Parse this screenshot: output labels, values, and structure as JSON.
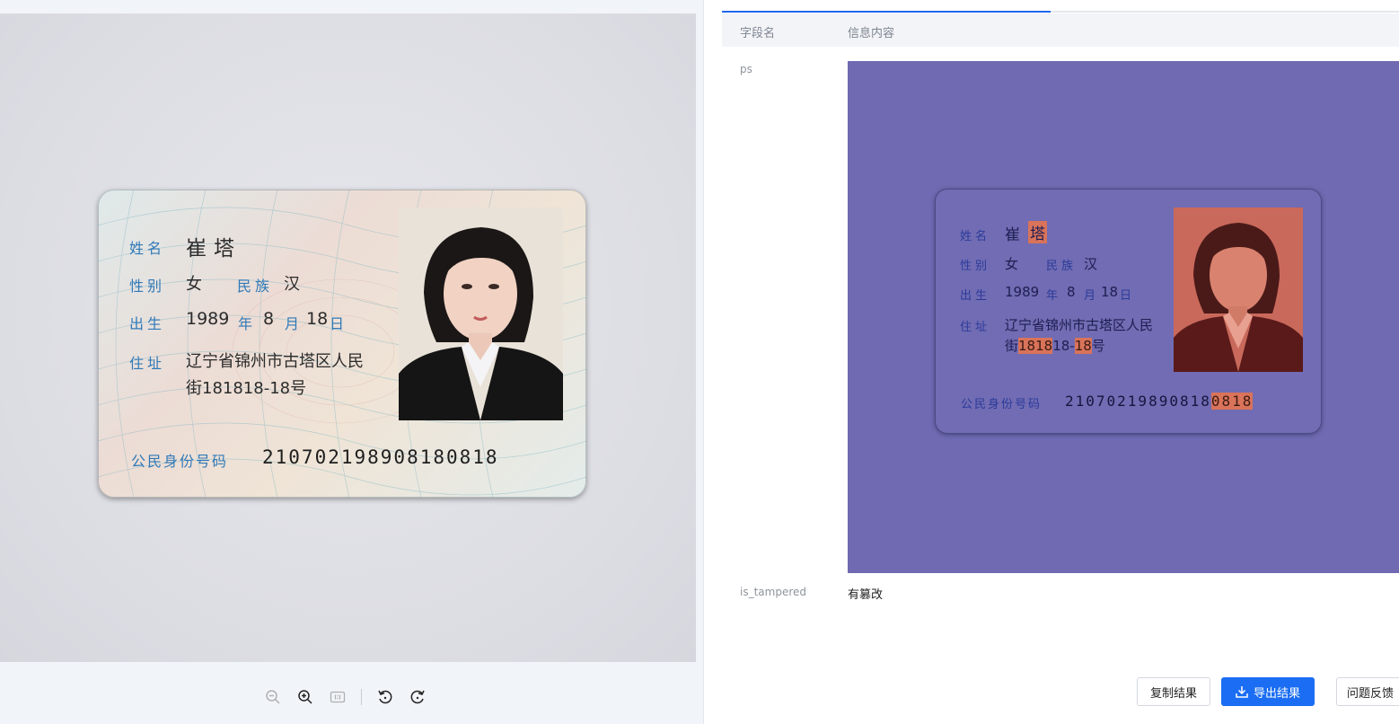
{
  "card": {
    "name_label": "姓名",
    "name": "崔塔",
    "sex_label": "性别",
    "sex": "女",
    "ethnic_label": "民族",
    "ethnic": "汉",
    "birth_label": "出生",
    "birth_year": "1989",
    "year_unit": "年",
    "birth_month": "8",
    "month_unit": "月",
    "birth_day": "18",
    "day_unit": "日",
    "address_label": "住址",
    "address_line1": "辽宁省锦州市古塔区人民",
    "address_line2": "街181818-18号",
    "id_label": "公民身份号码",
    "id_number": "210702198908180818"
  },
  "result_card": {
    "name_plain": "崔",
    "name_tampered": "塔",
    "address_line2_parts": [
      "街",
      "1818",
      "18-",
      "18",
      "号"
    ],
    "id_plain": "21070219890818",
    "id_tampered": "0818"
  },
  "table": {
    "header_field": "字段名",
    "header_content": "信息内容",
    "rows": [
      {
        "field": "ps"
      },
      {
        "field": "is_tampered",
        "value": "有篡改"
      }
    ]
  },
  "actions": {
    "copy": "复制结果",
    "export": "导出结果",
    "feedback": "问题反馈"
  },
  "colors": {
    "accent": "#1b6ef3",
    "overlay": "#6f6ab1",
    "tamper_highlight": "#d9735a"
  },
  "icons": [
    "zoom-out-icon",
    "zoom-in-icon",
    "actual-size-icon",
    "rotate-left-icon",
    "rotate-right-icon",
    "download-icon"
  ]
}
